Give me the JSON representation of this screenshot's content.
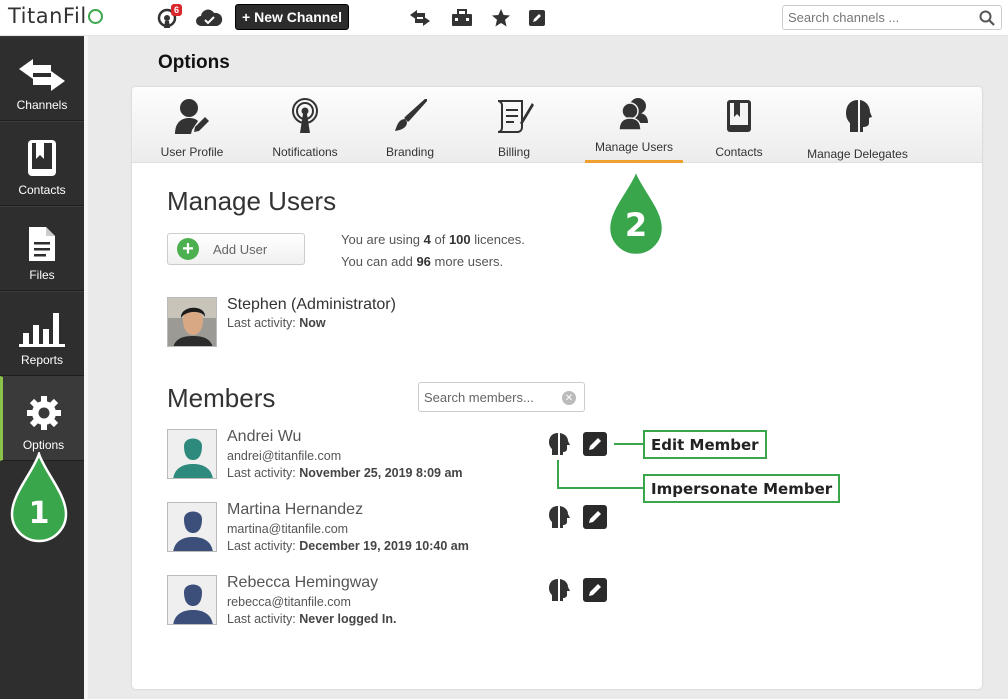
{
  "app": {
    "logo": "TitanFil"
  },
  "topbar": {
    "notifications_count": "6",
    "new_channel_label": "+ New Channel",
    "search_placeholder": "Search channels ..."
  },
  "sidebar": {
    "items": [
      {
        "label": "Channels",
        "icon": "arrows-icon"
      },
      {
        "label": "Contacts",
        "icon": "contacts-book-icon"
      },
      {
        "label": "Files",
        "icon": "file-icon"
      },
      {
        "label": "Reports",
        "icon": "bar-chart-icon"
      },
      {
        "label": "Options",
        "icon": "gear-icon",
        "active": true
      }
    ]
  },
  "page": {
    "title": "Options"
  },
  "tabs": [
    {
      "label": "User Profile"
    },
    {
      "label": "Notifications"
    },
    {
      "label": "Branding"
    },
    {
      "label": "Billing"
    },
    {
      "label": "Manage Users",
      "active": true
    },
    {
      "label": "Contacts"
    },
    {
      "label": "Manage Delegates"
    }
  ],
  "manage_users": {
    "title": "Manage Users",
    "add_user_label": "Add User",
    "licence_line1_prefix": "You are using ",
    "licence_used": "4",
    "licence_line1_mid": " of ",
    "licence_total": "100",
    "licence_line1_suffix": " licences.",
    "licence_line2_prefix": "You can add ",
    "licence_remaining": "96",
    "licence_line2_suffix": " more users.",
    "admin": {
      "name": "Stephen (Administrator)",
      "activity_label": "Last activity: ",
      "activity_value": "Now"
    }
  },
  "members": {
    "title": "Members",
    "search_placeholder": "Search members...",
    "list": [
      {
        "name": "Andrei Wu",
        "email": "andrei@titanfile.com",
        "activity_label": "Last activity: ",
        "activity_value": "November 25, 2019 8:09 am",
        "avatar_color": "#2e8a7c"
      },
      {
        "name": "Martina Hernandez",
        "email": "martina@titanfile.com",
        "activity_label": "Last activity: ",
        "activity_value": "December 19, 2019 10:40 am",
        "avatar_color": "#3b4f7a"
      },
      {
        "name": "Rebecca Hemingway",
        "email": "rebecca@titanfile.com",
        "activity_label": "Last activity: ",
        "activity_value": "Never logged In.",
        "avatar_color": "#3b4f7a"
      }
    ]
  },
  "annotations": {
    "step1": "1",
    "step2": "2",
    "edit_member": "Edit Member",
    "impersonate_member": "Impersonate Member"
  },
  "colors": {
    "accent_green": "#3aa64c",
    "tab_underline": "#f0a030",
    "sidebar_bg": "#2e2e2e"
  }
}
